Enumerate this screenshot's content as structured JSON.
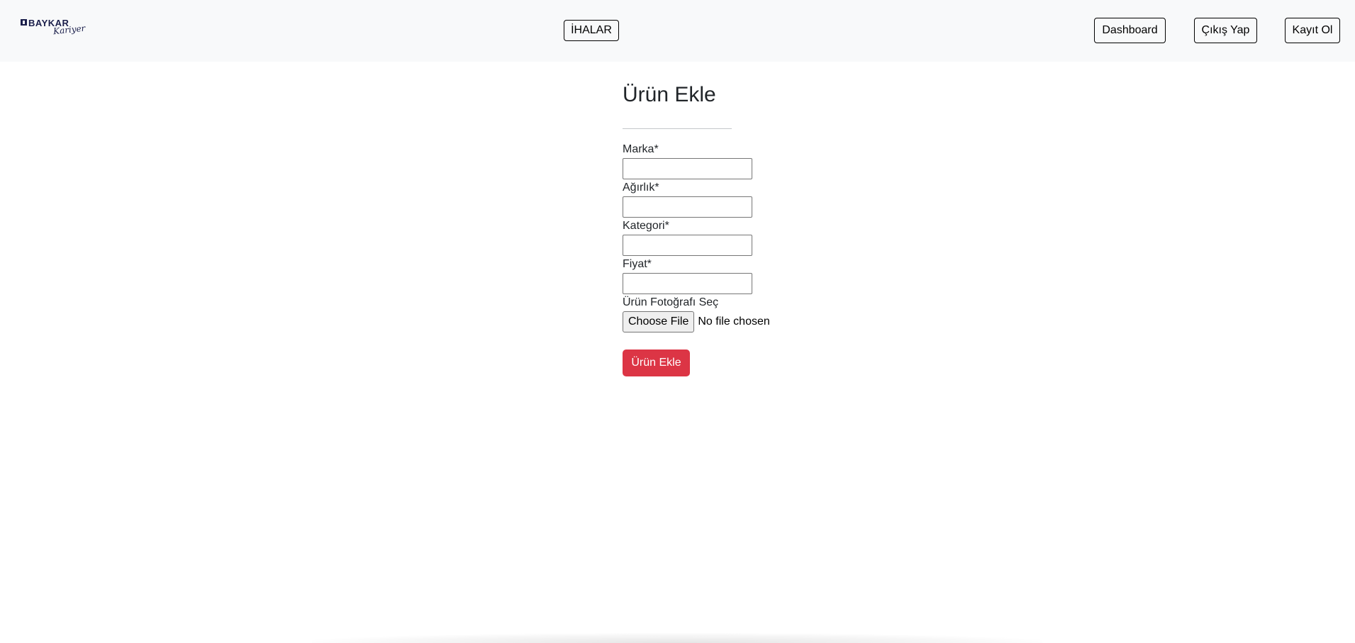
{
  "brand": {
    "logo_word": "BAYKAR",
    "logo_script": "Kariyer",
    "logo_color": "#1b1f4b"
  },
  "navbar": {
    "background": "#f8f9fa",
    "center_link": "İHALAR",
    "right_links": {
      "dashboard": "Dashboard",
      "logout": "Çıkış Yap",
      "register": "Kayıt Ol"
    }
  },
  "form": {
    "title": "Ürün Ekle",
    "fields": [
      {
        "label": "Marka*",
        "value": ""
      },
      {
        "label": "Ağırlık*",
        "value": ""
      },
      {
        "label": "Kategori*",
        "value": ""
      },
      {
        "label": "Fiyat*",
        "value": ""
      }
    ],
    "photo": {
      "label": "Ürün Fotoğrafı Seç",
      "button": "Choose File",
      "status": "No file chosen"
    },
    "submit": {
      "label": "Ürün Ekle",
      "color": "#dc3545"
    }
  }
}
